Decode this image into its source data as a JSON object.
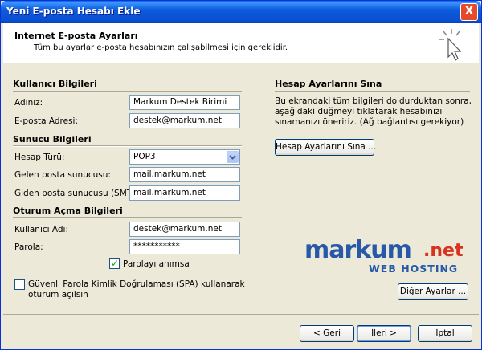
{
  "window": {
    "title": "Yeni E-posta Hesabı Ekle",
    "close_label": "X"
  },
  "header": {
    "title": "Internet E-posta Ayarları",
    "subtitle": "Tüm bu ayarlar e-posta hesabınızın çalışabilmesi için gereklidir."
  },
  "user_info": {
    "section_title": "Kullanıcı Bilgileri",
    "name_label": "Adınız:",
    "name_value": "Markum Destek Birimi",
    "email_label": "E-posta Adresi:",
    "email_value": "destek@markum.net"
  },
  "server_info": {
    "section_title": "Sunucu Bilgileri",
    "account_type_label": "Hesap Türü:",
    "account_type_value": "POP3",
    "incoming_label": "Gelen posta sunucusu:",
    "incoming_value": "mail.markum.net",
    "outgoing_label": "Giden posta sunucusu (SMTP):",
    "outgoing_value": "mail.markum.net"
  },
  "login_info": {
    "section_title": "Oturum Açma Bilgileri",
    "username_label": "Kullanıcı Adı:",
    "username_value": "destek@markum.net",
    "password_label": "Parola:",
    "password_value": "***********",
    "remember_label": "Parolayı anımsa",
    "remember_checked": true,
    "spa_label": "Güvenli Parola Kimlik Doğrulaması (SPA) kullanarak oturum açılsın",
    "spa_checked": false
  },
  "test": {
    "section_title": "Hesap Ayarlarını Sına",
    "description": "Bu ekrandaki tüm bilgileri doldurduktan sonra, aşağıdaki düğmeyi tıklatarak hesabınızı sınamanızı öneririz. (Ağ bağlantısı gerekiyor)",
    "button_label": "Hesap Ayarlarını Sına ..."
  },
  "logo": {
    "markum": "markum",
    "net": ".net",
    "tagline": "WEB HOSTING"
  },
  "more_settings_label": "Diğer Ayarlar ...",
  "footer": {
    "back_label": "< Geri",
    "next_label": "İleri >",
    "cancel_label": "İptal"
  },
  "colors": {
    "title_bar": "#0a5fe4",
    "logo_blue": "#2759a8",
    "logo_red": "#d9331f",
    "check": "#21a121"
  }
}
